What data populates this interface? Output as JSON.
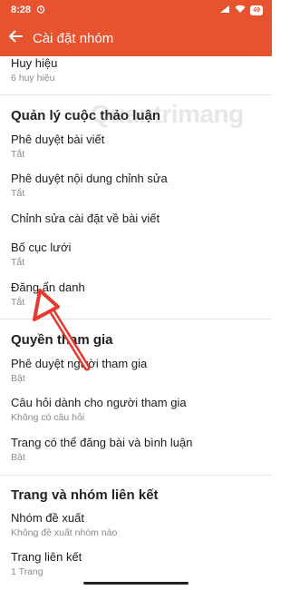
{
  "status_bar": {
    "time": "8:28",
    "battery": "49"
  },
  "app_bar": {
    "title": "Cài đặt nhóm"
  },
  "watermark": "Quantrimang",
  "rows": {
    "badges": {
      "title": "Huy hiệu",
      "subtitle": "6 huy hiệu"
    },
    "approve_posts": {
      "title": "Phê duyệt bài viết",
      "subtitle": "Tắt"
    },
    "approve_edits": {
      "title": "Phê duyệt nội dung chỉnh sửa",
      "subtitle": "Tắt"
    },
    "edit_post_settings": {
      "title": "Chỉnh sửa cài đặt về bài viết"
    },
    "grid_layout": {
      "title": "Bố cục lưới",
      "subtitle": "Tắt"
    },
    "anonymous_posting": {
      "title": "Đăng ẩn danh",
      "subtitle": "Tắt"
    },
    "approve_members": {
      "title": "Phê duyệt người tham gia",
      "subtitle": "Bật"
    },
    "member_questions": {
      "title": "Câu hỏi dành cho người tham gia",
      "subtitle": "Không có câu hỏi"
    },
    "page_can_post": {
      "title": "Trang có thể đăng bài và bình luận",
      "subtitle": "Bật"
    },
    "suggested_groups": {
      "title": "Nhóm đề xuất",
      "subtitle": "Không đề xuất nhóm nào"
    },
    "linked_pages": {
      "title": "Trang liên kết",
      "subtitle": "1 Trang"
    }
  },
  "sections": {
    "discussion": "Quản lý cuộc thảo luận",
    "participation": "Quyền tham gia",
    "linked": "Trang và nhóm liên kết"
  },
  "colors": {
    "accent": "#e8532f",
    "arrow": "#e63a2e"
  },
  "icons": [
    "alarm-icon",
    "wifi-icon",
    "signal-icon",
    "battery-icon",
    "back-arrow-icon"
  ]
}
